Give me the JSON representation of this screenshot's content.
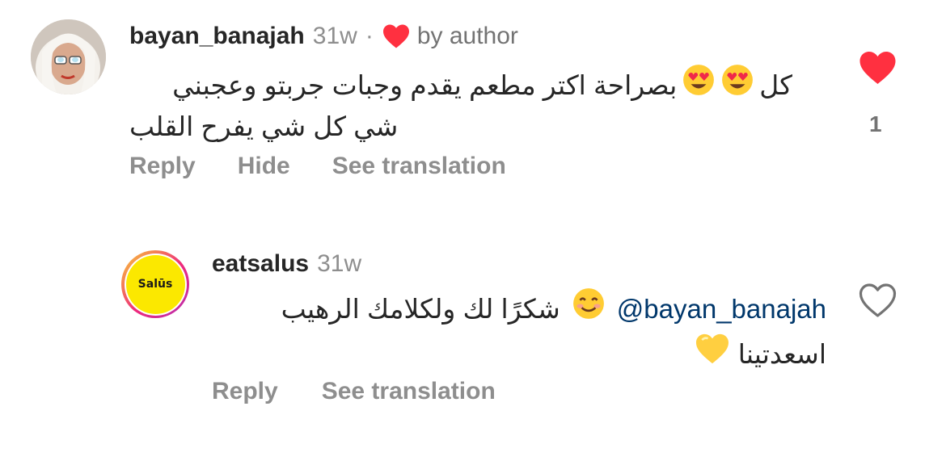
{
  "comments": [
    {
      "username": "bayan_banajah",
      "time": "31w",
      "separator": "·",
      "badge": "by author",
      "text_line1": "بصراحة اكتر مطعم يقدم وجبات جربتو وعجبني",
      "text_line1_suffix": "كل",
      "text_line2": "شي كل شي يفرح القلب",
      "emoji": [
        "heart-eyes-emoji",
        "heart-eyes-emoji"
      ],
      "actions": {
        "reply": "Reply",
        "hide": "Hide",
        "translate": "See translation"
      },
      "like_count": "1",
      "liked": true,
      "like_color": "#ff3040"
    },
    {
      "username": "eatsalus",
      "time": "31w",
      "avatar_text": "Salūs",
      "mention": "@bayan_banajah",
      "text_line1": "شكرًا لك ولكلامك الرهيب",
      "text_line2": "اسعدتينا",
      "emoji": [
        "smiling-face-emoji",
        "yellow-heart-emoji"
      ],
      "actions": {
        "reply": "Reply",
        "translate": "See translation"
      },
      "liked": false
    }
  ]
}
